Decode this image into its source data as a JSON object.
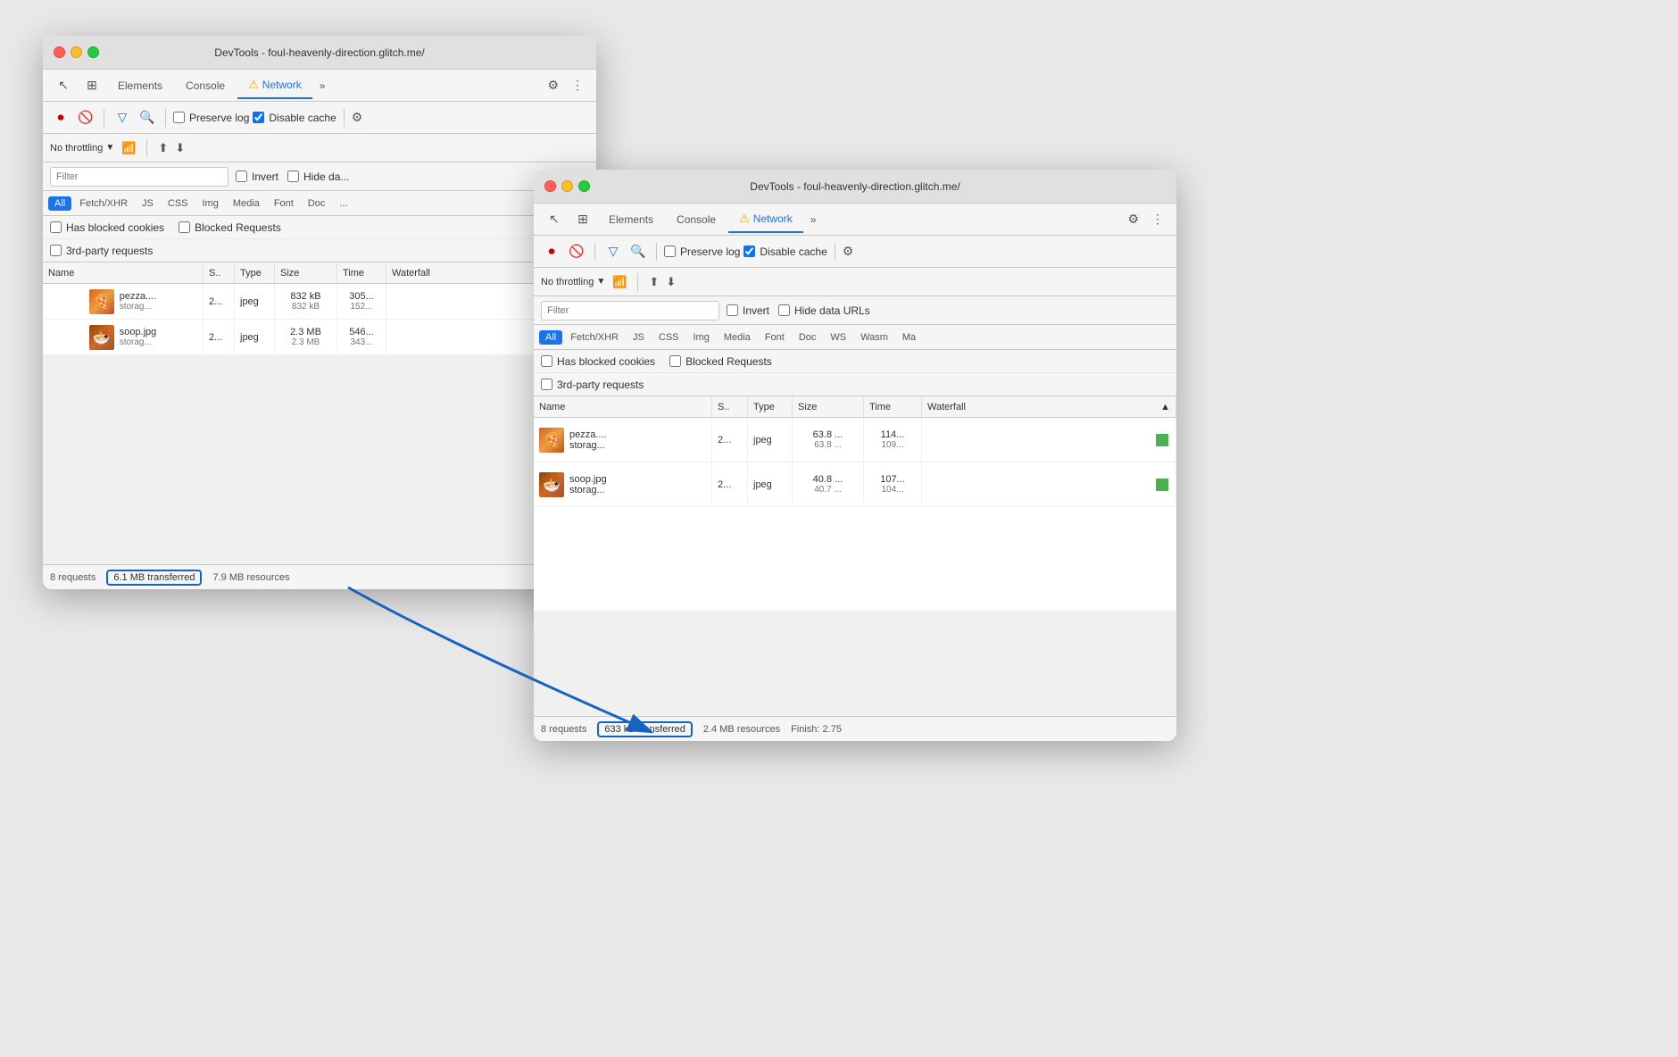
{
  "window1": {
    "title": "DevTools - foul-heavenly-direction.glitch.me/",
    "tabs": [
      "Elements",
      "Console",
      "Network"
    ],
    "activeTab": "Network",
    "toolbar": {
      "preserveLog": false,
      "disableCache": true
    },
    "throttling": "No throttling",
    "filter": {
      "placeholder": "Filter",
      "invert": false,
      "hideDataURLs": false
    },
    "typeFilters": [
      "All",
      "Fetch/XHR",
      "JS",
      "CSS",
      "Img",
      "Media",
      "Font",
      "Doc"
    ],
    "activeTypeFilter": "All",
    "checkboxes": {
      "hasBlockedCookies": "Has blocked cookies",
      "blockedRequests": "Blocked Requests",
      "thirdPartyRequests": "3rd-party requests"
    },
    "tableHeaders": [
      "Name",
      "S..",
      "Type",
      "Size",
      "Time",
      "Waterfall"
    ],
    "rows": [
      {
        "thumb": "pizza",
        "name": "pezza....",
        "sub": "storag...",
        "status": "2...",
        "type": "jpeg",
        "size": "832 kB",
        "sizeTransferred": "832 kB",
        "time": "305...",
        "time2": "152..."
      },
      {
        "thumb": "soup",
        "name": "soop.jpg",
        "sub": "storag...",
        "status": "2...",
        "type": "jpeg",
        "size": "2.3 MB",
        "sizeTransferred": "2.3 MB",
        "time": "546...",
        "time2": "343..."
      }
    ],
    "statusBar": {
      "requests": "8 requests",
      "transferred": "6.1 MB transferred",
      "resources": "7.9 MB resources"
    }
  },
  "window2": {
    "title": "DevTools - foul-heavenly-direction.glitch.me/",
    "tabs": [
      "Elements",
      "Console",
      "Network"
    ],
    "activeTab": "Network",
    "toolbar": {
      "preserveLog": false,
      "disableCache": true
    },
    "throttling": "No throttling",
    "filter": {
      "placeholder": "Filter",
      "invert": false,
      "hideDataURLs": false
    },
    "typeFilters": [
      "All",
      "Fetch/XHR",
      "JS",
      "CSS",
      "Img",
      "Media",
      "Font",
      "Doc",
      "WS",
      "Wasm",
      "Ma"
    ],
    "activeTypeFilter": "All",
    "checkboxes": {
      "hasBlockedCookies": "Has blocked cookies",
      "blockedRequests": "Blocked Requests",
      "thirdPartyRequests": "3rd-party requests"
    },
    "tableHeaders": [
      "Name",
      "S..",
      "Type",
      "Size",
      "Time",
      "Waterfall"
    ],
    "rows": [
      {
        "thumb": "pizza",
        "name": "pezza....",
        "sub": "storag...",
        "status": "2...",
        "type": "jpeg",
        "size": "63.8 ...",
        "sizeTransferred": "63.8 ...",
        "time": "114...",
        "time2": "109..."
      },
      {
        "thumb": "soup",
        "name": "soop.jpg",
        "sub": "storag...",
        "status": "2...",
        "type": "jpeg",
        "size": "40.8 ...",
        "sizeTransferred": "40.7 ...",
        "time": "107...",
        "time2": "104..."
      }
    ],
    "statusBar": {
      "requests": "8 requests",
      "transferred": "633 kB transferred",
      "resources": "2.4 MB resources",
      "finish": "Finish: 2.75"
    }
  },
  "icons": {
    "record": "⏺",
    "clear": "🚫",
    "filter": "⚗",
    "search": "🔍",
    "gear": "⚙",
    "dots": "⋮",
    "chevron": "▼",
    "wifi": "📶",
    "upload": "⬆",
    "download": "⬇",
    "cursor": "↖",
    "layers": "⊞",
    "more": "»",
    "warning": "⚠"
  }
}
